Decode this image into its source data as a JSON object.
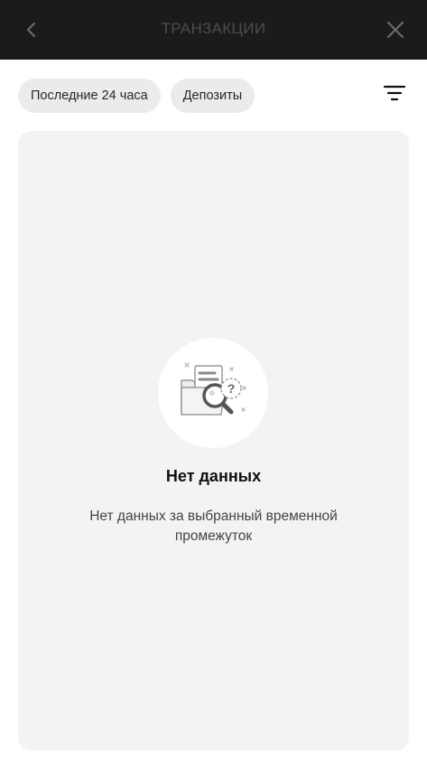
{
  "header": {
    "title": "ТРАНЗАКЦИИ",
    "back_icon": "chevron-left-icon",
    "close_icon": "close-icon"
  },
  "filters": {
    "chips": [
      {
        "label": "Последние 24 часа"
      },
      {
        "label": "Депозиты"
      }
    ],
    "filter_icon": "filter-icon"
  },
  "empty_state": {
    "icon": "document-search-icon",
    "title": "Нет данных",
    "description": "Нет данных за выбранный временной промежуток"
  },
  "colors": {
    "header_bg": "#1b1b1b",
    "panel_bg": "#f3f3f3",
    "chip_bg": "#ebebeb"
  }
}
